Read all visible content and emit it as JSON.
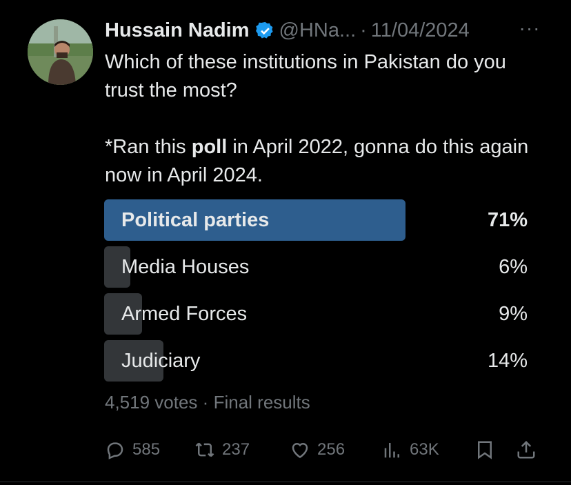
{
  "author": {
    "name": "Hussain Nadim",
    "handle": "@HNa...",
    "date": "11/04/2024",
    "separator": "·",
    "verified": true
  },
  "more_label": "···",
  "tweet": {
    "line1": "Which of these institutions in Pakistan do you trust the most?",
    "line2_before": "*Ran this ",
    "line2_bold": "poll",
    "line2_after": " in April 2022, gonna do this again now in April 2024."
  },
  "poll": {
    "options": [
      {
        "label": "Political parties",
        "percent_text": "71%",
        "percent": 71,
        "winner": true
      },
      {
        "label": "Media Houses",
        "percent_text": "6%",
        "percent": 6,
        "winner": false
      },
      {
        "label": "Armed Forces",
        "percent_text": "9%",
        "percent": 9,
        "winner": false
      },
      {
        "label": "Judiciary",
        "percent_text": "14%",
        "percent": 14,
        "winner": false
      }
    ],
    "votes": "4,519 votes",
    "separator": "·",
    "status": "Final results"
  },
  "actions": {
    "replies": "585",
    "reposts": "237",
    "likes": "256",
    "views": "63K"
  },
  "colors": {
    "accent": "#1d9bf0",
    "winner_bar": "#2e5e8e",
    "bar": "#333639",
    "muted": "#71767b",
    "text": "#e7e9ea",
    "background": "#000000"
  },
  "icons": [
    "reply-icon",
    "repost-icon",
    "like-icon",
    "views-icon",
    "bookmark-icon",
    "share-icon",
    "verified-badge-icon",
    "more-icon"
  ]
}
